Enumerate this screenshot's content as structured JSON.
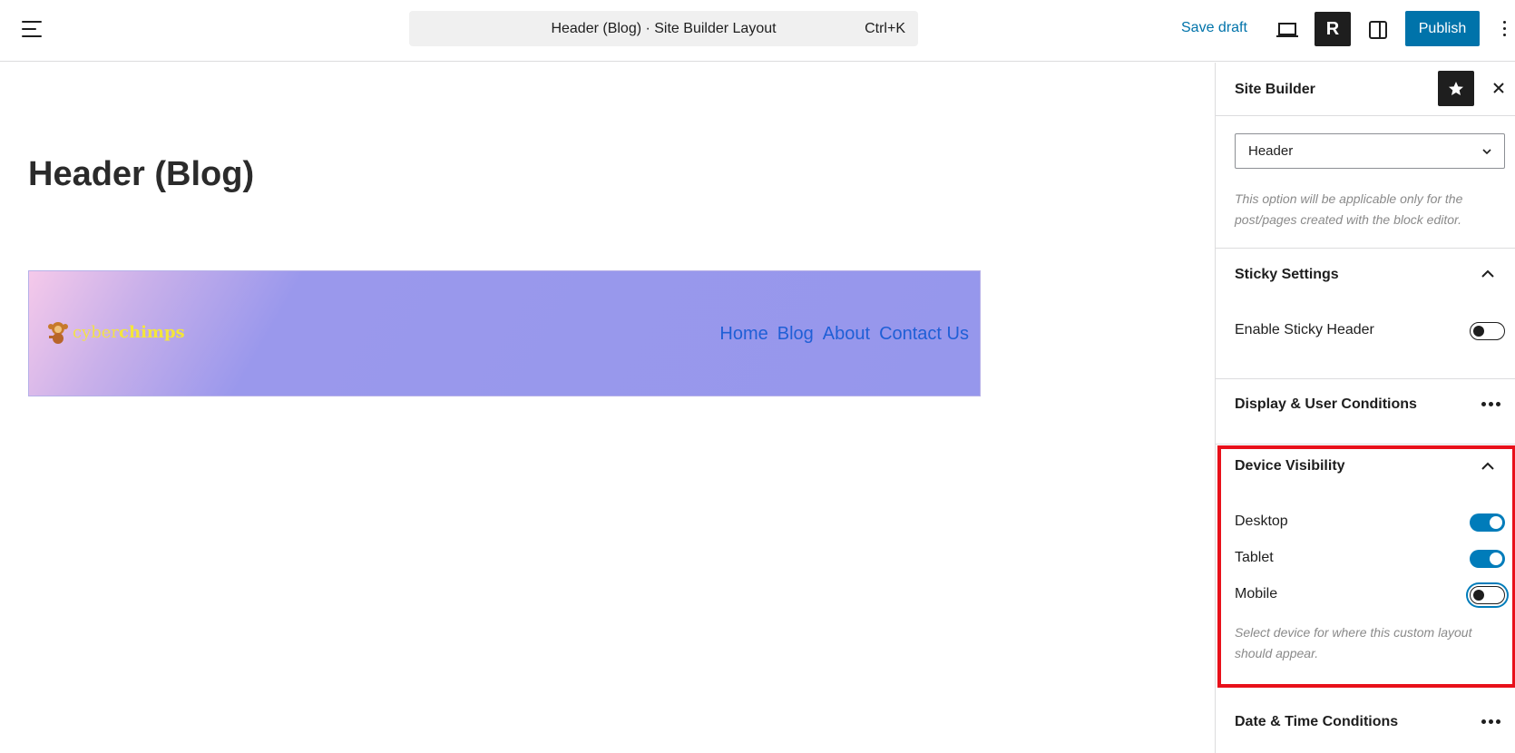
{
  "topbar": {
    "command_title": "Header (Blog) · Site Builder Layout",
    "command_shortcut": "Ctrl+K",
    "save_draft": "Save draft",
    "r_label": "R",
    "publish": "Publish"
  },
  "canvas": {
    "page_title": "Header (Blog)",
    "logo": {
      "part1": "cyber",
      "part2": "chimps"
    },
    "nav": [
      "Home",
      "Blog",
      "About",
      "Contact Us"
    ]
  },
  "sidebar": {
    "title": "Site Builder",
    "select_value": "Header",
    "select_help": "This option will be applicable only for the post/pages created with the block editor.",
    "sticky": {
      "title": "Sticky Settings",
      "label": "Enable Sticky Header",
      "enabled": false
    },
    "display_conditions": {
      "title": "Display & User Conditions"
    },
    "device_visibility": {
      "title": "Device Visibility",
      "items": [
        {
          "label": "Desktop",
          "enabled": true
        },
        {
          "label": "Tablet",
          "enabled": true
        },
        {
          "label": "Mobile",
          "enabled": false
        }
      ],
      "help": "Select device for where this custom layout should appear."
    },
    "date_time": {
      "title": "Date & Time Conditions"
    }
  },
  "colors": {
    "accent": "#007cba",
    "highlight": "#e8101a",
    "nav_link": "#1f5fd6"
  }
}
